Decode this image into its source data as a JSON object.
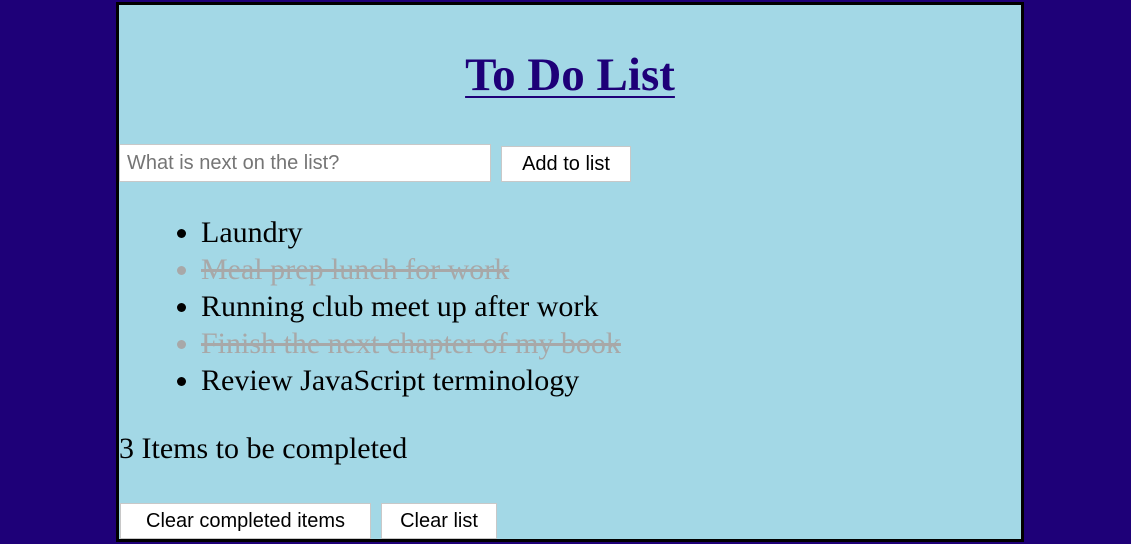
{
  "app": {
    "title": "To Do List"
  },
  "add_form": {
    "input_value": "",
    "input_placeholder": "What is next on the list?",
    "add_button_label": "Add to list"
  },
  "items": [
    {
      "text": "Laundry",
      "completed": false
    },
    {
      "text": "Meal prep lunch for work",
      "completed": true
    },
    {
      "text": "Running club meet up after work",
      "completed": false
    },
    {
      "text": "Finish the next chapter of my book",
      "completed": true
    },
    {
      "text": "Review JavaScript terminology",
      "completed": false
    }
  ],
  "summary": {
    "remaining_text": "3 Items to be completed"
  },
  "footer": {
    "clear_completed_label": "Clear completed items",
    "clear_list_label": "Clear list"
  },
  "colors": {
    "page_background": "#1e0078",
    "panel_background": "#a3d8e6",
    "title_color": "#1e0078",
    "completed_item_color": "#a8a8a8"
  }
}
